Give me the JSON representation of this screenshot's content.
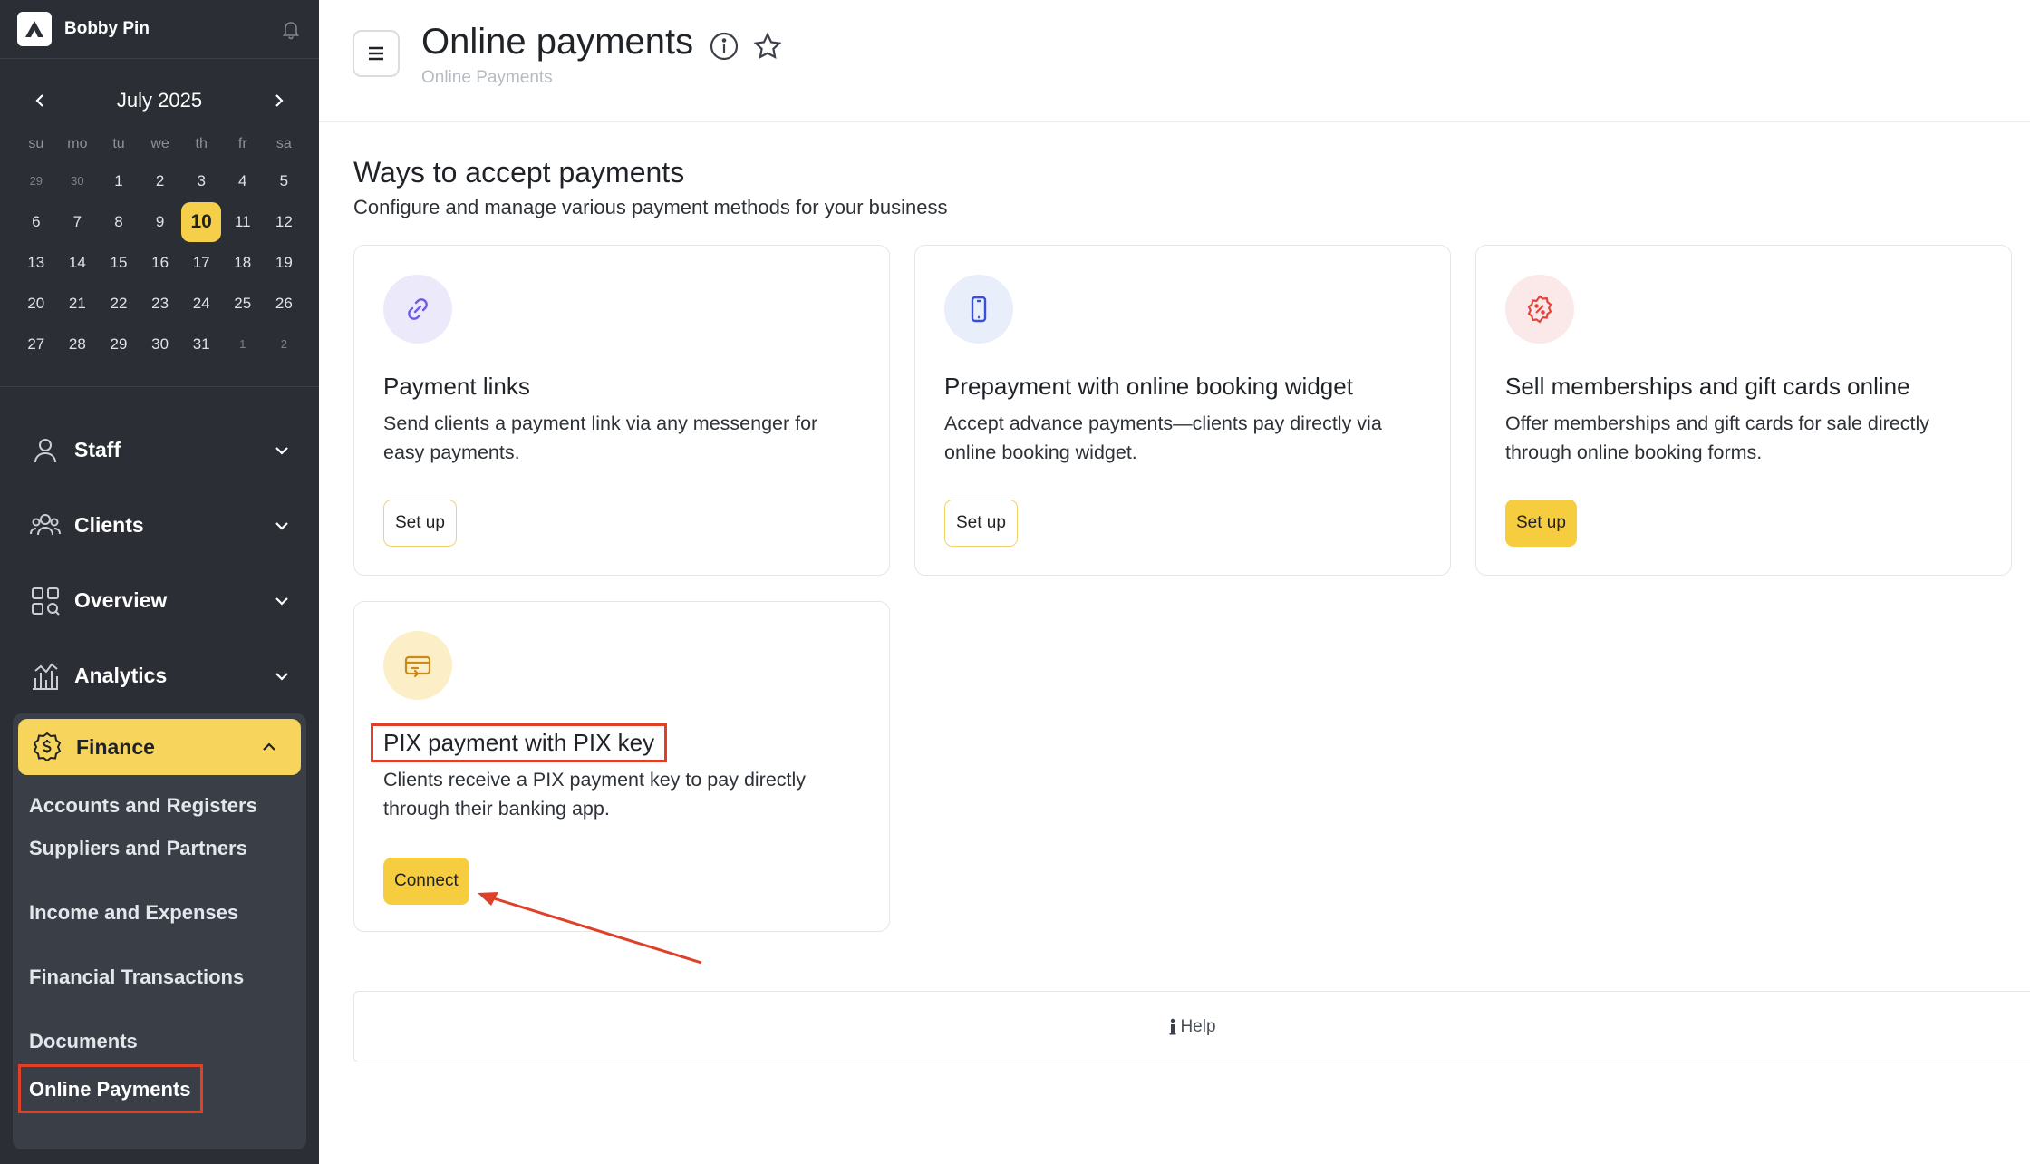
{
  "account": {
    "name": "Bobby Pin"
  },
  "calendar": {
    "title": "July 2025",
    "weekdays": [
      "su",
      "mo",
      "tu",
      "we",
      "th",
      "fr",
      "sa"
    ],
    "weeks": [
      [
        "29",
        "30",
        "1",
        "2",
        "3",
        "4",
        "5"
      ],
      [
        "6",
        "7",
        "8",
        "9",
        "10",
        "11",
        "12"
      ],
      [
        "13",
        "14",
        "15",
        "16",
        "17",
        "18",
        "19"
      ],
      [
        "20",
        "21",
        "22",
        "23",
        "24",
        "25",
        "26"
      ],
      [
        "27",
        "28",
        "29",
        "30",
        "31",
        "1",
        "2"
      ]
    ],
    "today": "10"
  },
  "nav": {
    "staff": "Staff",
    "clients": "Clients",
    "overview": "Overview",
    "analytics": "Analytics",
    "finance": "Finance",
    "finance_items": [
      "Accounts and Registers",
      "Suppliers and Partners",
      "Income and Expenses",
      "Financial Transactions",
      "Documents",
      "Online Payments"
    ]
  },
  "header": {
    "title": "Online payments",
    "breadcrumb": "Online Payments"
  },
  "section": {
    "title": "Ways to accept payments",
    "subtitle": "Configure and manage various payment methods for your business"
  },
  "cards": [
    {
      "title": "Payment links",
      "desc": "Send clients a payment link via any messenger for easy payments.",
      "button": "Set up",
      "icon": "link-icon"
    },
    {
      "title": "Prepayment with online booking widget",
      "desc": "Accept advance payments—clients pay directly via online booking widget.",
      "button": "Set up",
      "icon": "mobile-phone-icon"
    },
    {
      "title": "Sell memberships and gift cards online",
      "desc": "Offer memberships and gift cards for sale directly through online booking forms.",
      "button": "Set up",
      "icon": "discount-badge-icon"
    },
    {
      "title": "PIX payment with PIX key",
      "desc": "Clients receive a PIX payment key to pay directly through their banking app.",
      "button": "Connect",
      "icon": "payment-terminal-icon"
    }
  ],
  "help": {
    "label": "Help"
  },
  "colors": {
    "accent": "#f5cd3f",
    "sidebar": "#2b2f35",
    "highlight": "#e04028"
  }
}
